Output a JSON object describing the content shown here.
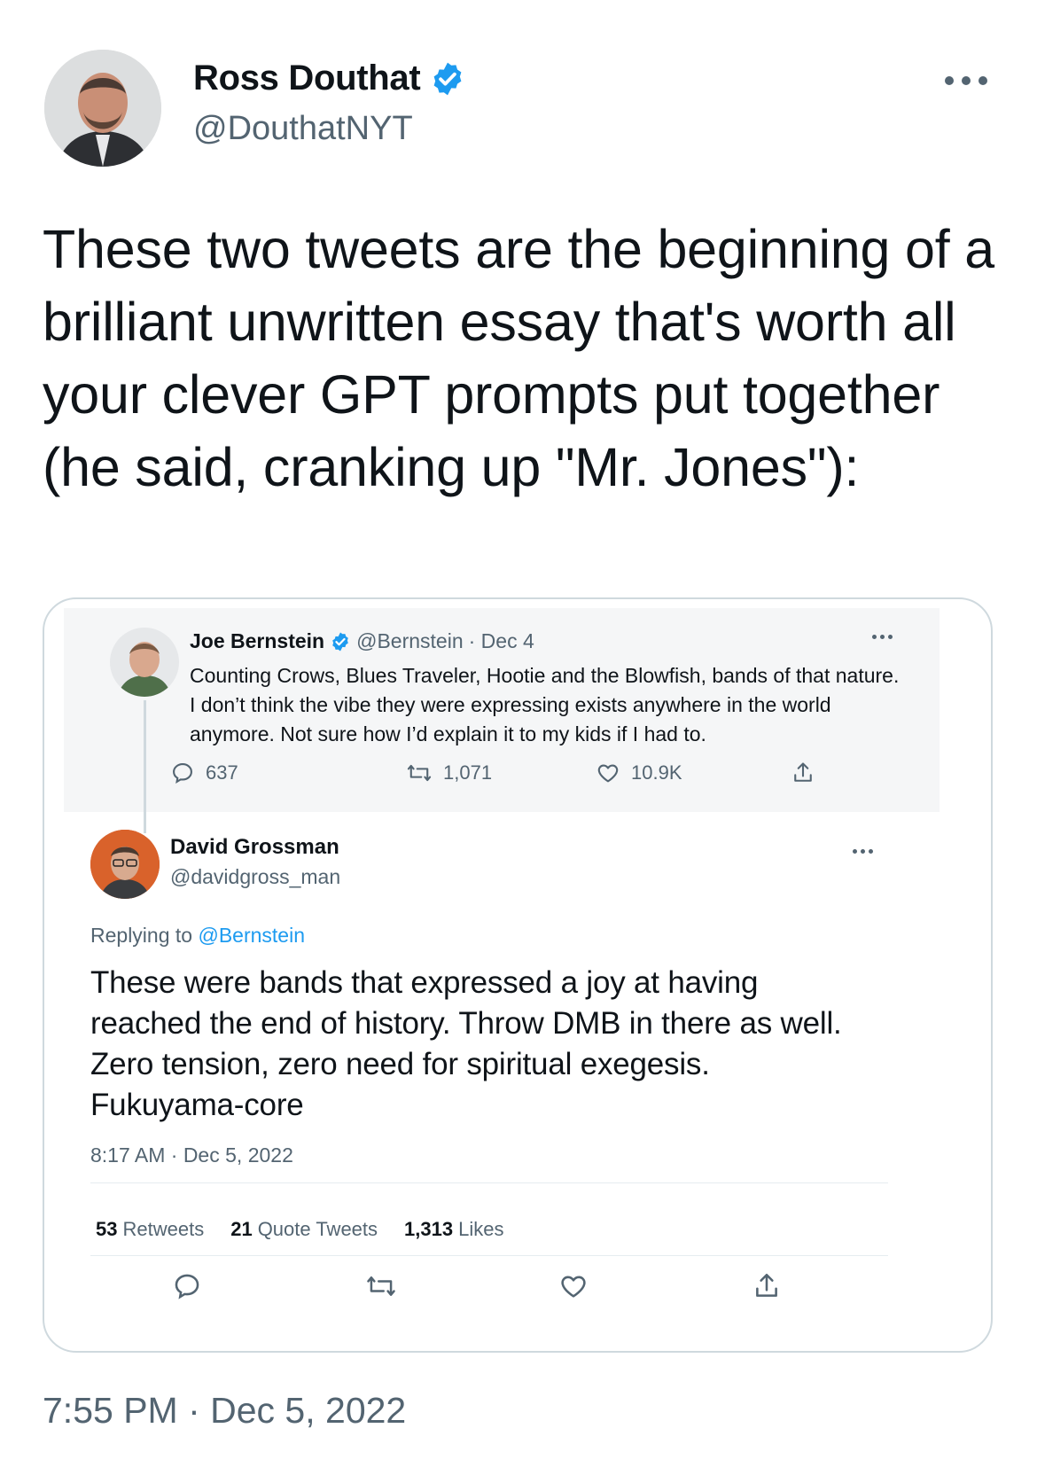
{
  "author": {
    "name": "Ross Douthat",
    "handle": "@DouthatNYT"
  },
  "tweet": {
    "text": "These two tweets are the beginning of a brilliant unwritten essay that's worth all your clever GPT prompts put together (he said, cranking up \"Mr. Jones\"):",
    "timestamp": "7:55 PM · Dec 5, 2022"
  },
  "embedded": {
    "quoted": {
      "name": "Joe Bernstein",
      "handle": "@Bernstein",
      "date": "· Dec 4",
      "text": "Counting Crows, Blues Traveler, Hootie and the Blowfish, bands of that nature. I don’t think the vibe they were expressing exists anywhere in the world anymore. Not sure how I’d explain it to my kids if I had to.",
      "replies": "637",
      "retweets": "1,071",
      "likes": "10.9K"
    },
    "reply": {
      "name": "David Grossman",
      "handle": "@davidgross_man",
      "replying_prefix": "Replying to",
      "replying_to": "@Bernstein",
      "text": "These were bands that expressed a joy at having reached the end of history. Throw DMB in there as well. Zero tension, zero need for spiritual exegesis. Fukuyama-core",
      "timestamp": "8:17 AM · Dec 5, 2022",
      "stats": {
        "retweets_count": "53",
        "retweets_label": "Retweets",
        "quotes_count": "21",
        "quotes_label": "Quote Tweets",
        "likes_count": "1,313",
        "likes_label": "Likes"
      }
    }
  },
  "colors": {
    "verified": "#1d9bf0",
    "muted": "#536471",
    "link": "#1d9bf0"
  }
}
